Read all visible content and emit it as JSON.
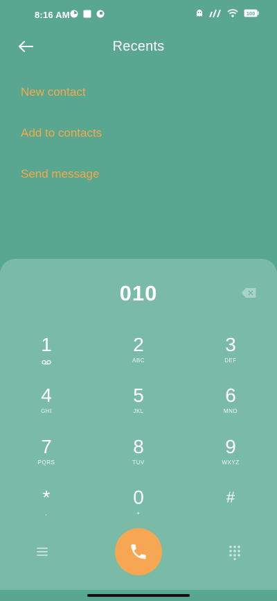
{
  "status_bar": {
    "time": "8:16 AM",
    "battery": "100",
    "icons": [
      "app-notification-icon",
      "square-notification-icon",
      "app-notification-icon",
      "ghost-icon",
      "signal-icon",
      "wifi-icon",
      "battery-icon"
    ]
  },
  "header": {
    "title": "Recents",
    "back_icon": "back-arrow-icon"
  },
  "actions": [
    {
      "label": "New contact"
    },
    {
      "label": "Add to contacts"
    },
    {
      "label": "Send message"
    }
  ],
  "dialer": {
    "number": "010",
    "keys": [
      {
        "digit": "1",
        "letters": "voicemail-icon"
      },
      {
        "digit": "2",
        "letters": "ABC"
      },
      {
        "digit": "3",
        "letters": "DEF"
      },
      {
        "digit": "4",
        "letters": "GHI"
      },
      {
        "digit": "5",
        "letters": "JKL"
      },
      {
        "digit": "6",
        "letters": "MNO"
      },
      {
        "digit": "7",
        "letters": "PQRS"
      },
      {
        "digit": "8",
        "letters": "TUV"
      },
      {
        "digit": "9",
        "letters": "WXYZ"
      },
      {
        "digit": "*",
        "letters": ","
      },
      {
        "digit": "0",
        "letters": "+"
      },
      {
        "digit": "#",
        "letters": ""
      }
    ]
  },
  "colors": {
    "background": "#5aa791",
    "panel": "#79bba7",
    "accent": "#f4a94a",
    "call_button": "#f7a753"
  }
}
